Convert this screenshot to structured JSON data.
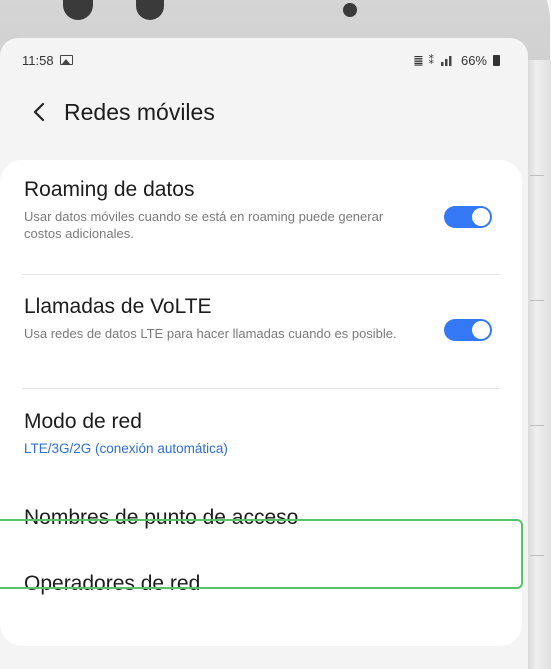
{
  "status_bar": {
    "time": "11:58",
    "network": "䷀ ⁑",
    "battery": "66%"
  },
  "header": {
    "back_icon": "chevron-left-icon",
    "title": "Redes móviles"
  },
  "settings": [
    {
      "title": "Roaming de datos",
      "subtitle": "Usar datos móviles cuando se está en roaming puede generar costos adicionales.",
      "toggle": true
    },
    {
      "title": "Llamadas de VoLTE",
      "subtitle": "Usa redes de datos LTE para hacer llamadas cuando es posible.",
      "toggle": true
    },
    {
      "title": "Modo de red",
      "subtitle": "LTE/3G/2G (conexión automática)"
    },
    {
      "title": "Nombres de punto de acceso",
      "highlighted": true
    },
    {
      "title": "Operadores de red"
    }
  ],
  "colors": {
    "toggle_on": "#3478f6",
    "accent_text": "#2f6fce",
    "highlight_border": "#58c36a"
  }
}
